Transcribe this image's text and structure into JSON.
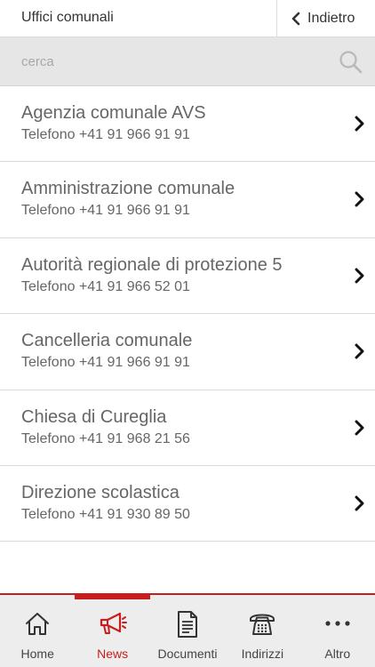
{
  "header": {
    "title": "Uffici comunali",
    "back_label": "Indietro"
  },
  "search": {
    "placeholder": "cerca",
    "value": ""
  },
  "offices": [
    {
      "name": "Agenzia comunale AVS",
      "phone": "Telefono +41 91 966 91 91"
    },
    {
      "name": "Amministrazione comunale",
      "phone": "Telefono +41 91 966 91 91"
    },
    {
      "name": "Autorità regionale di protezione 5",
      "phone": "Telefono +41 91 966 52 01"
    },
    {
      "name": "Cancelleria comunale",
      "phone": "Telefono +41 91 966 91 91"
    },
    {
      "name": "Chiesa di Cureglia",
      "phone": "Telefono +41 91 968 21 56"
    },
    {
      "name": "Direzione scolastica",
      "phone": "Telefono +41 91 930 89 50"
    }
  ],
  "tabs": [
    {
      "label": "Home",
      "icon": "home-icon",
      "active": false
    },
    {
      "label": "News",
      "icon": "megaphone-icon",
      "active": true
    },
    {
      "label": "Documenti",
      "icon": "document-icon",
      "active": false
    },
    {
      "label": "Indirizzi",
      "icon": "telephone-icon",
      "active": false
    },
    {
      "label": "Altro",
      "icon": "more-icon",
      "active": false
    }
  ],
  "colors": {
    "accent": "#c81e1e",
    "text": "#666666",
    "search_bg": "#e6e6e6",
    "tabbar_bg": "#ededed"
  }
}
